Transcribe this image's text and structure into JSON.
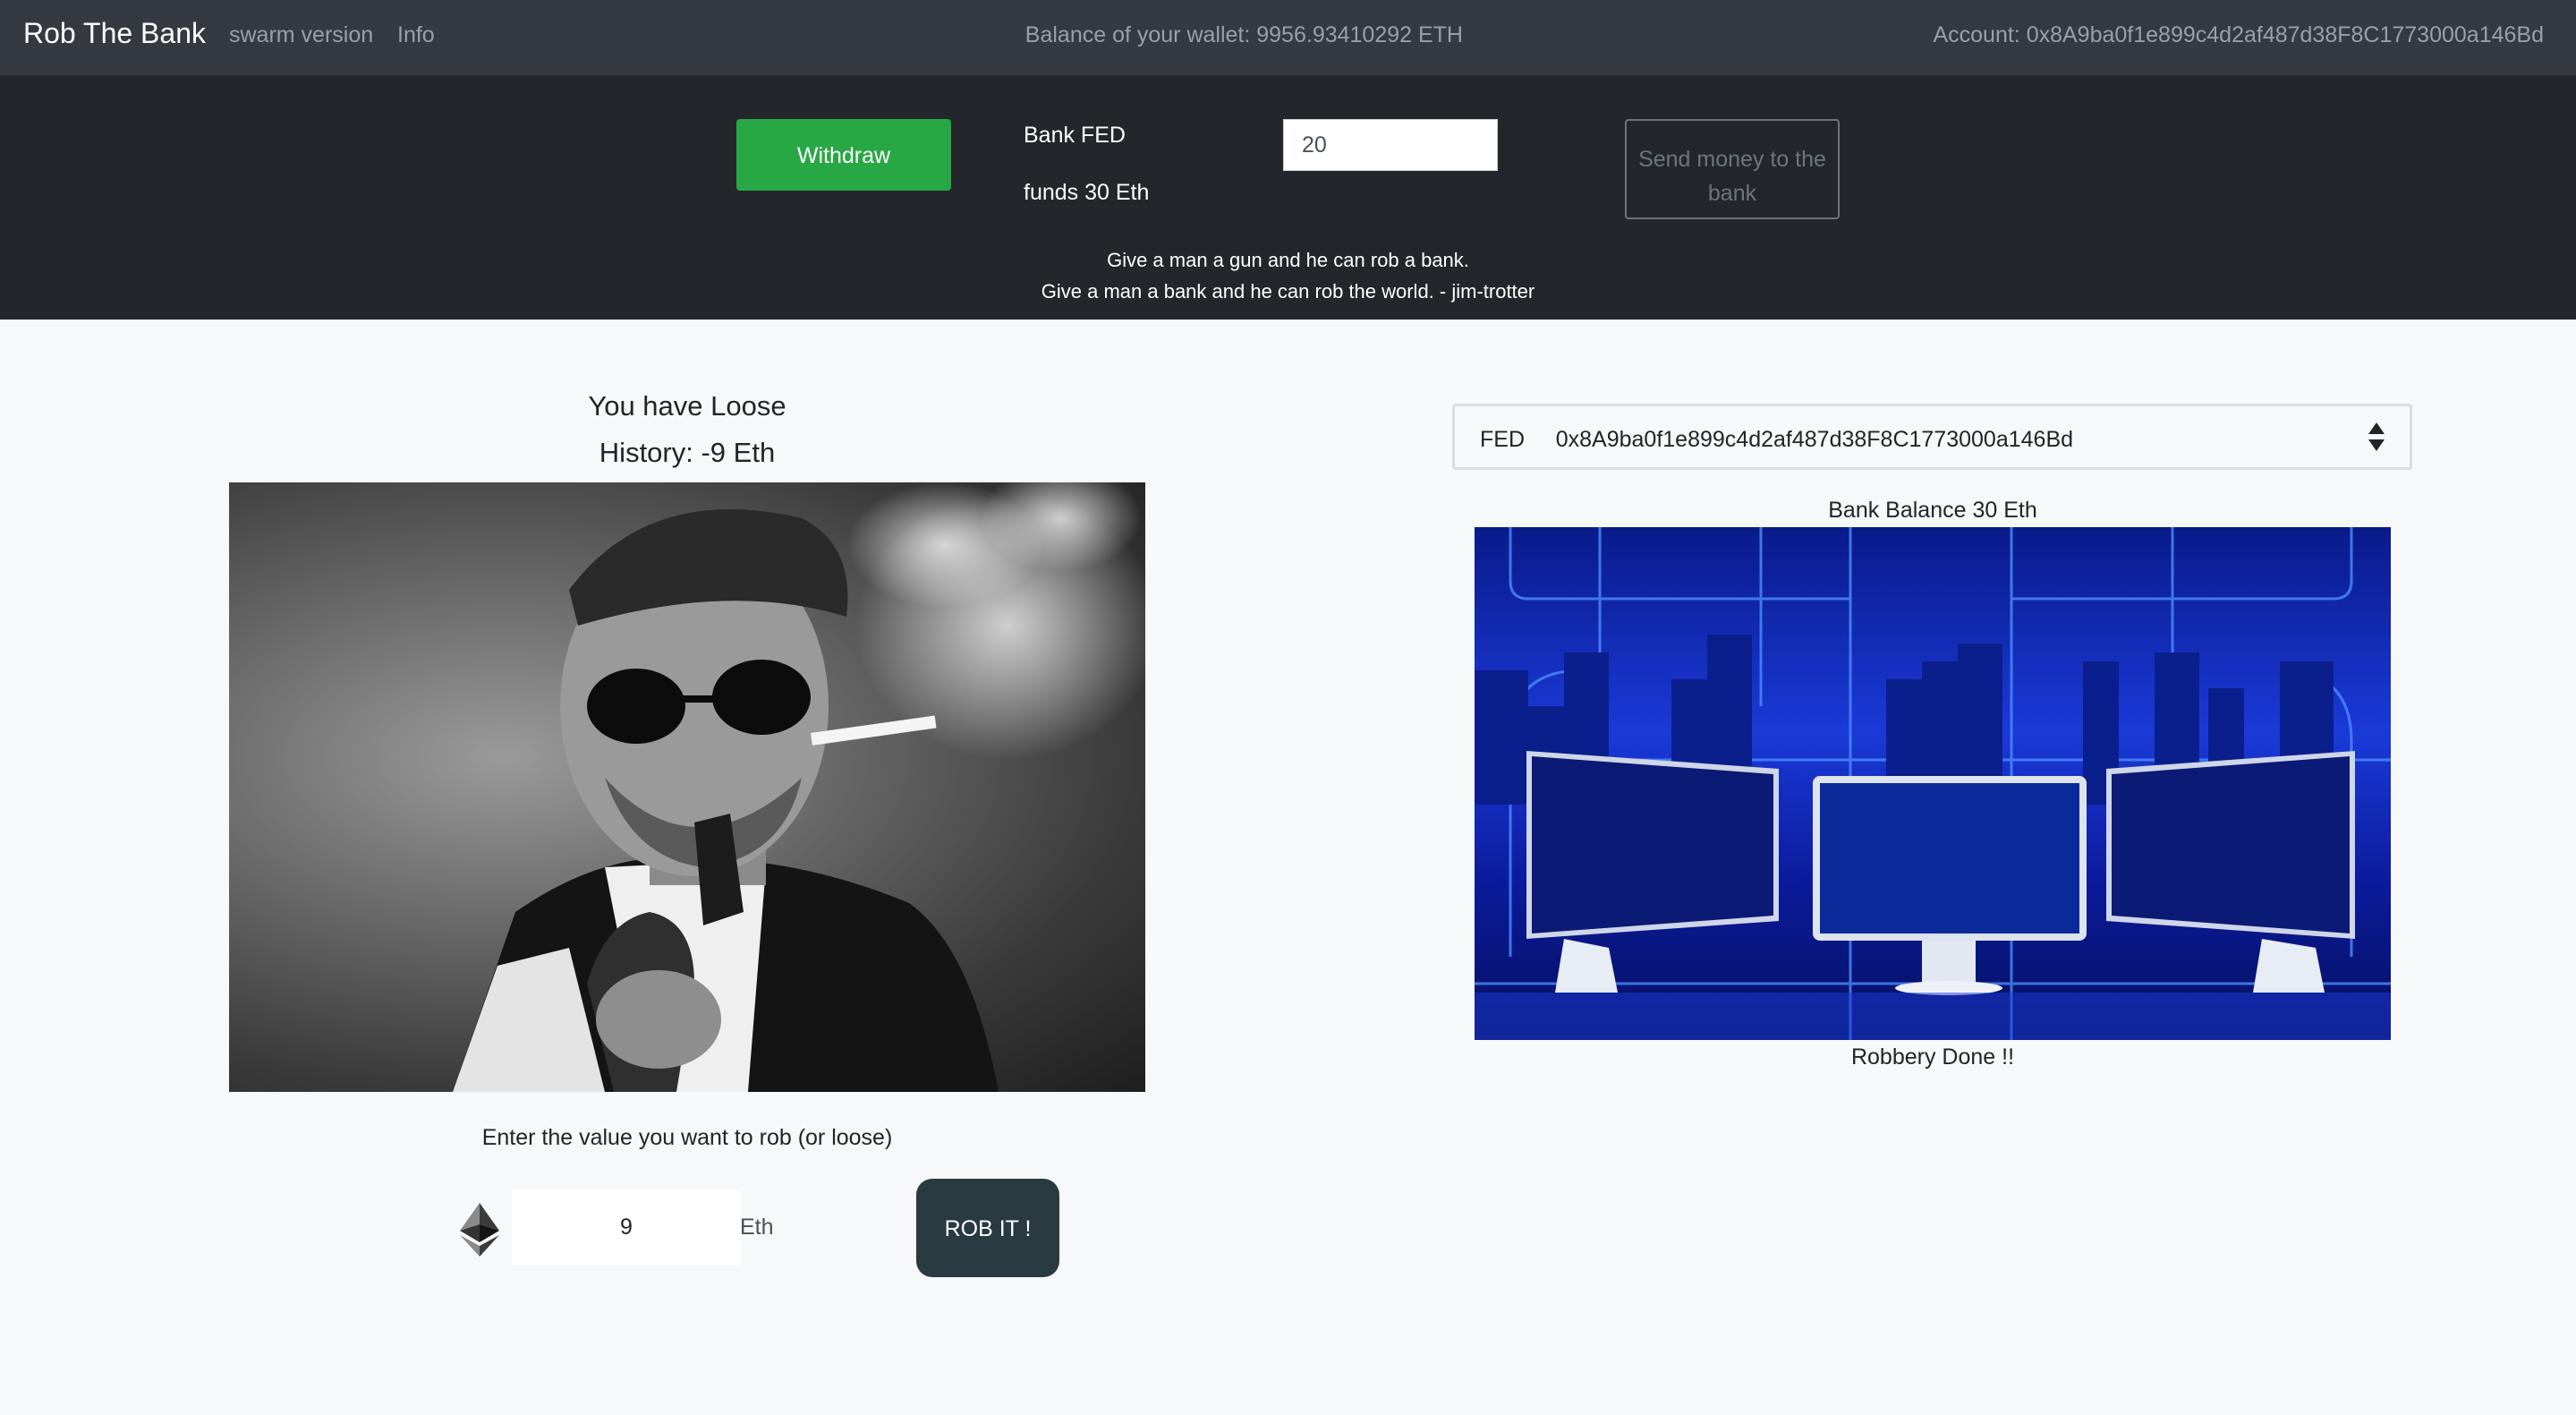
{
  "navbar": {
    "brand": "Rob The Bank",
    "links": [
      "swarm version",
      "Info"
    ],
    "balance_text": "Balance of your wallet: 9956.93410292 ETH",
    "account_text": "Account: 0x8A9ba0f1e899c4d2af487d38F8C1773000a146Bd"
  },
  "bank_panel": {
    "withdraw_label": "Withdraw",
    "bank_name": "Bank FED",
    "bank_funds": "funds 30 Eth",
    "amount_value": "20",
    "send_label": "Send money to the bank",
    "quote_line1": "Give a man a gun and he can rob a bank.",
    "quote_line2": "Give a man a bank and he can rob the world. - jim-trotter"
  },
  "game": {
    "result_title": "You have Loose",
    "history": "History: -9 Eth",
    "enter_label": "Enter the value you want to rob (or loose)",
    "rob_value": "9",
    "unit": "Eth",
    "rob_button": "ROB IT !"
  },
  "bank": {
    "select_value": "FED     0x8A9ba0f1e899c4d2af487d38F8C1773000a146Bd",
    "balance": "Bank Balance 30 Eth",
    "status": "Robbery Done !!"
  },
  "icons": {
    "currency": "ethereum-icon",
    "select": "updown-arrows-icon"
  },
  "colors": {
    "navbar_bg": "#343a40",
    "panel_bg": "#23272b",
    "withdraw_green": "#28a745",
    "rob_button_bg": "#2a3a41",
    "page_bg": "#f7f8fa"
  }
}
